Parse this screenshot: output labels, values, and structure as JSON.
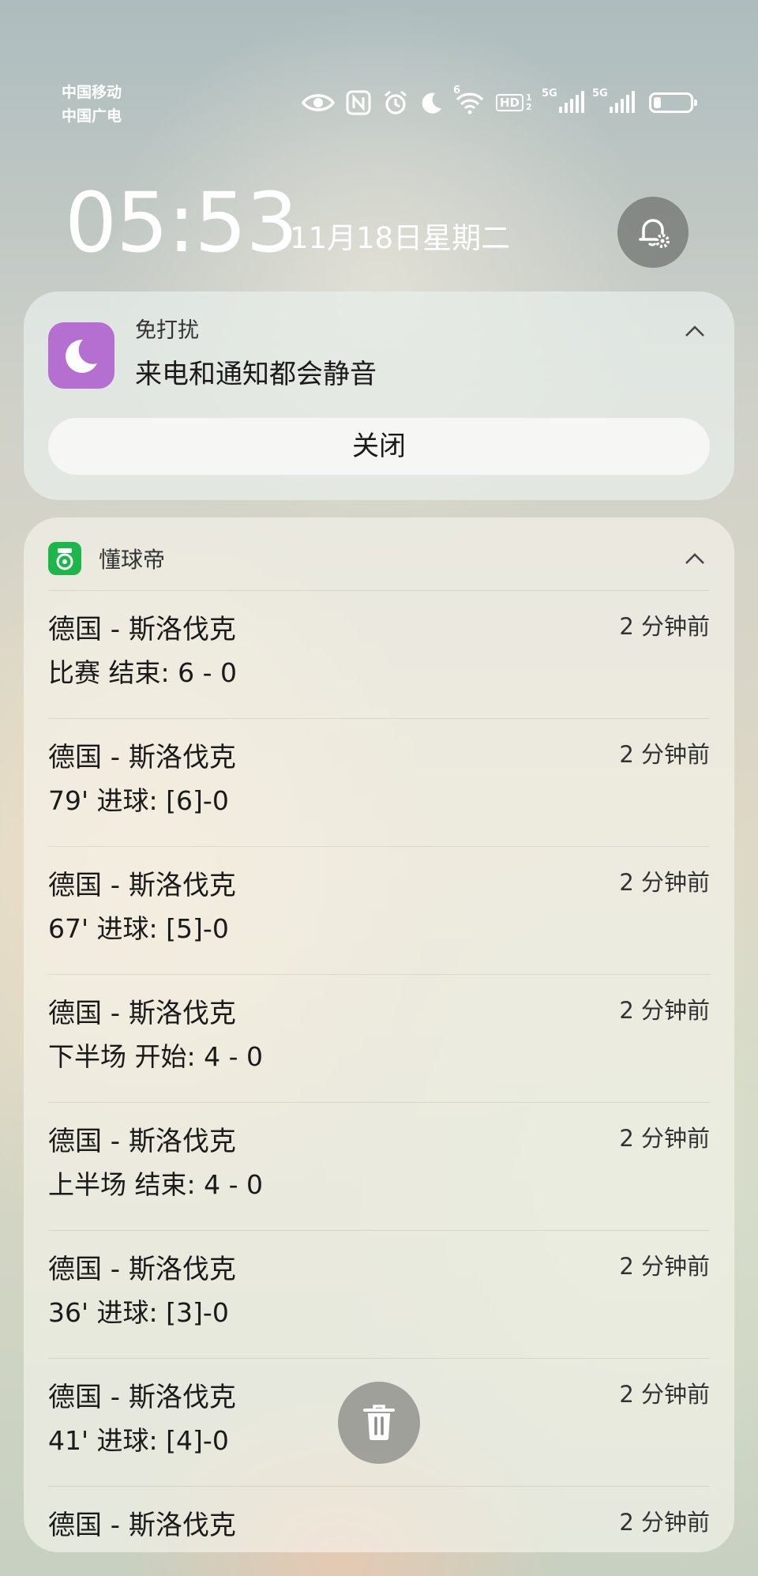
{
  "status_bar": {
    "carrier_1": "中国移动",
    "carrier_2": "中国广电",
    "wifi_label": "6",
    "hd_label": "HD",
    "hd_sub": "1 2",
    "net_1": "5G",
    "net_2": "5G",
    "icons": [
      "eye-icon",
      "nfc-icon",
      "alarm-icon",
      "moon-icon",
      "wifi-icon",
      "hd-icon",
      "signal-icon",
      "signal-icon",
      "battery-icon"
    ],
    "battery_level": 0.2
  },
  "lock": {
    "time": "05:53",
    "date": "11月18日星期二"
  },
  "dnd_card": {
    "app_name": "免打扰",
    "text": "来电和通知都会静音",
    "close_label": "关闭",
    "icon_color": "#b46fd1"
  },
  "news_card": {
    "app_name": "懂球帝",
    "icon_color": "#1db64a",
    "items": [
      {
        "title": "德国 - 斯洛伐克",
        "time": "2 分钟前",
        "body": "比赛 结束: 6 - 0"
      },
      {
        "title": "德国 - 斯洛伐克",
        "time": "2 分钟前",
        "body": "79' 进球: [6]-0"
      },
      {
        "title": "德国 - 斯洛伐克",
        "time": "2 分钟前",
        "body": "67' 进球: [5]-0"
      },
      {
        "title": "德国 - 斯洛伐克",
        "time": "2 分钟前",
        "body": "下半场 开始: 4 - 0"
      },
      {
        "title": "德国 - 斯洛伐克",
        "time": "2 分钟前",
        "body": "上半场 结束: 4 - 0"
      },
      {
        "title": "德国 - 斯洛伐克",
        "time": "2 分钟前",
        "body": "36' 进球: [3]-0"
      },
      {
        "title": "德国 - 斯洛伐克",
        "time": "2 分钟前",
        "body": "41' 进球: [4]-0"
      },
      {
        "title": "德国 - 斯洛伐克",
        "time": "2 分钟前",
        "body": ""
      }
    ]
  }
}
